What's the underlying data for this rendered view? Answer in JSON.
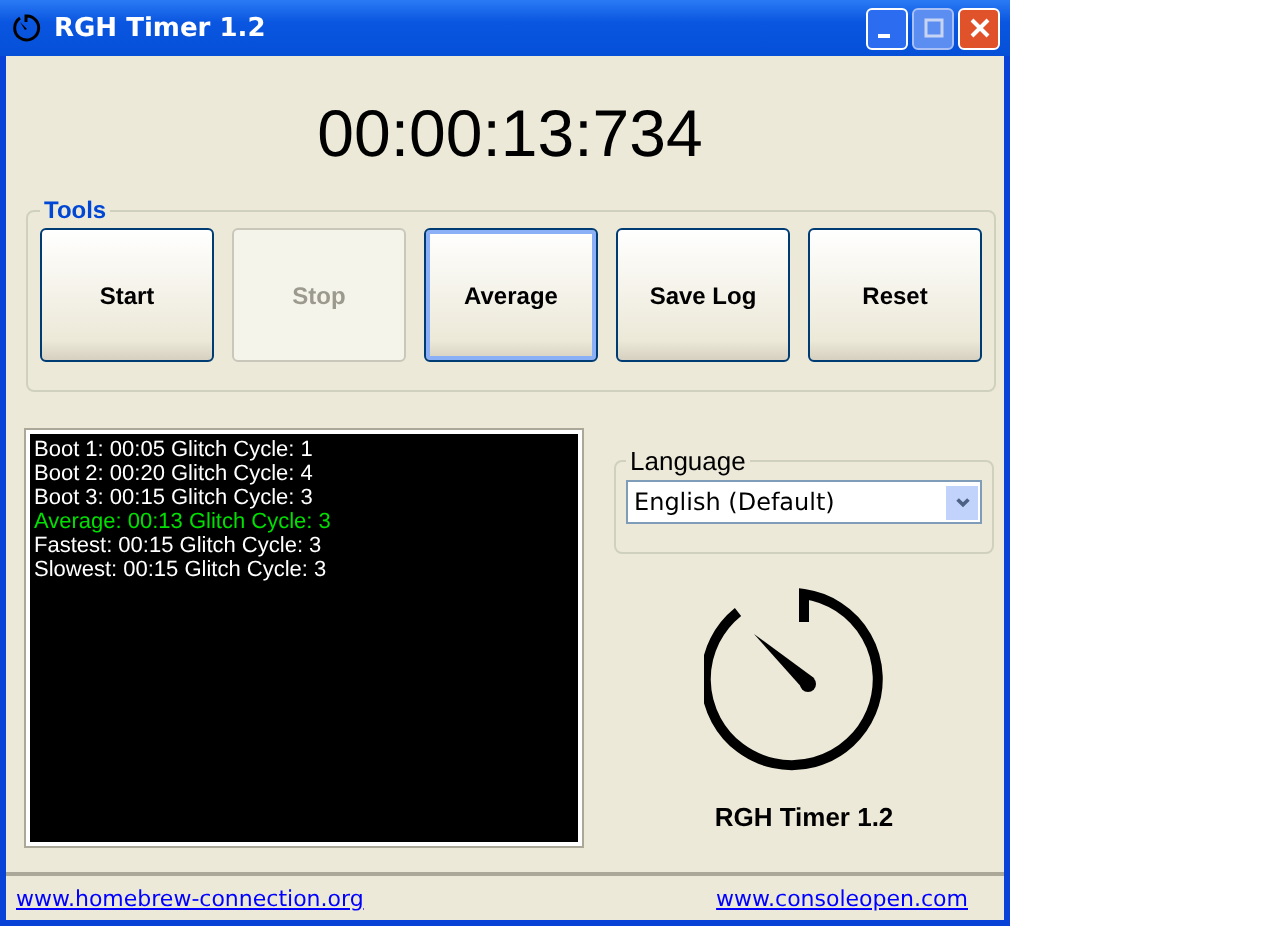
{
  "window": {
    "title": "RGH Timer 1.2"
  },
  "timer": "00:00:13:734",
  "tools": {
    "title": "Tools",
    "buttons": [
      {
        "label": "Start",
        "disabled": false,
        "focused": false
      },
      {
        "label": "Stop",
        "disabled": true,
        "focused": false
      },
      {
        "label": "Average",
        "disabled": false,
        "focused": true
      },
      {
        "label": "Save Log",
        "disabled": false,
        "focused": false
      },
      {
        "label": "Reset",
        "disabled": false,
        "focused": false
      }
    ]
  },
  "log": [
    {
      "text": "Boot 1: 00:05 Glitch Cycle: 1",
      "color": "#ffffff"
    },
    {
      "text": "Boot 2: 00:20 Glitch Cycle: 4",
      "color": "#ffffff"
    },
    {
      "text": "Boot 3: 00:15 Glitch Cycle: 3",
      "color": "#ffffff"
    },
    {
      "text": "Average: 00:13 Glitch Cycle: 3",
      "color": "#00e000"
    },
    {
      "text": "Fastest: 00:15 Glitch Cycle: 3",
      "color": "#ffffff"
    },
    {
      "text": "Slowest: 00:15 Glitch Cycle: 3",
      "color": "#ffffff"
    }
  ],
  "language": {
    "title": "Language",
    "value": "English (Default)"
  },
  "logo_caption": "RGH Timer 1.2",
  "status_bar": {
    "links": [
      "www.homebrew-connection.org",
      "www.consoleopen.com"
    ]
  }
}
